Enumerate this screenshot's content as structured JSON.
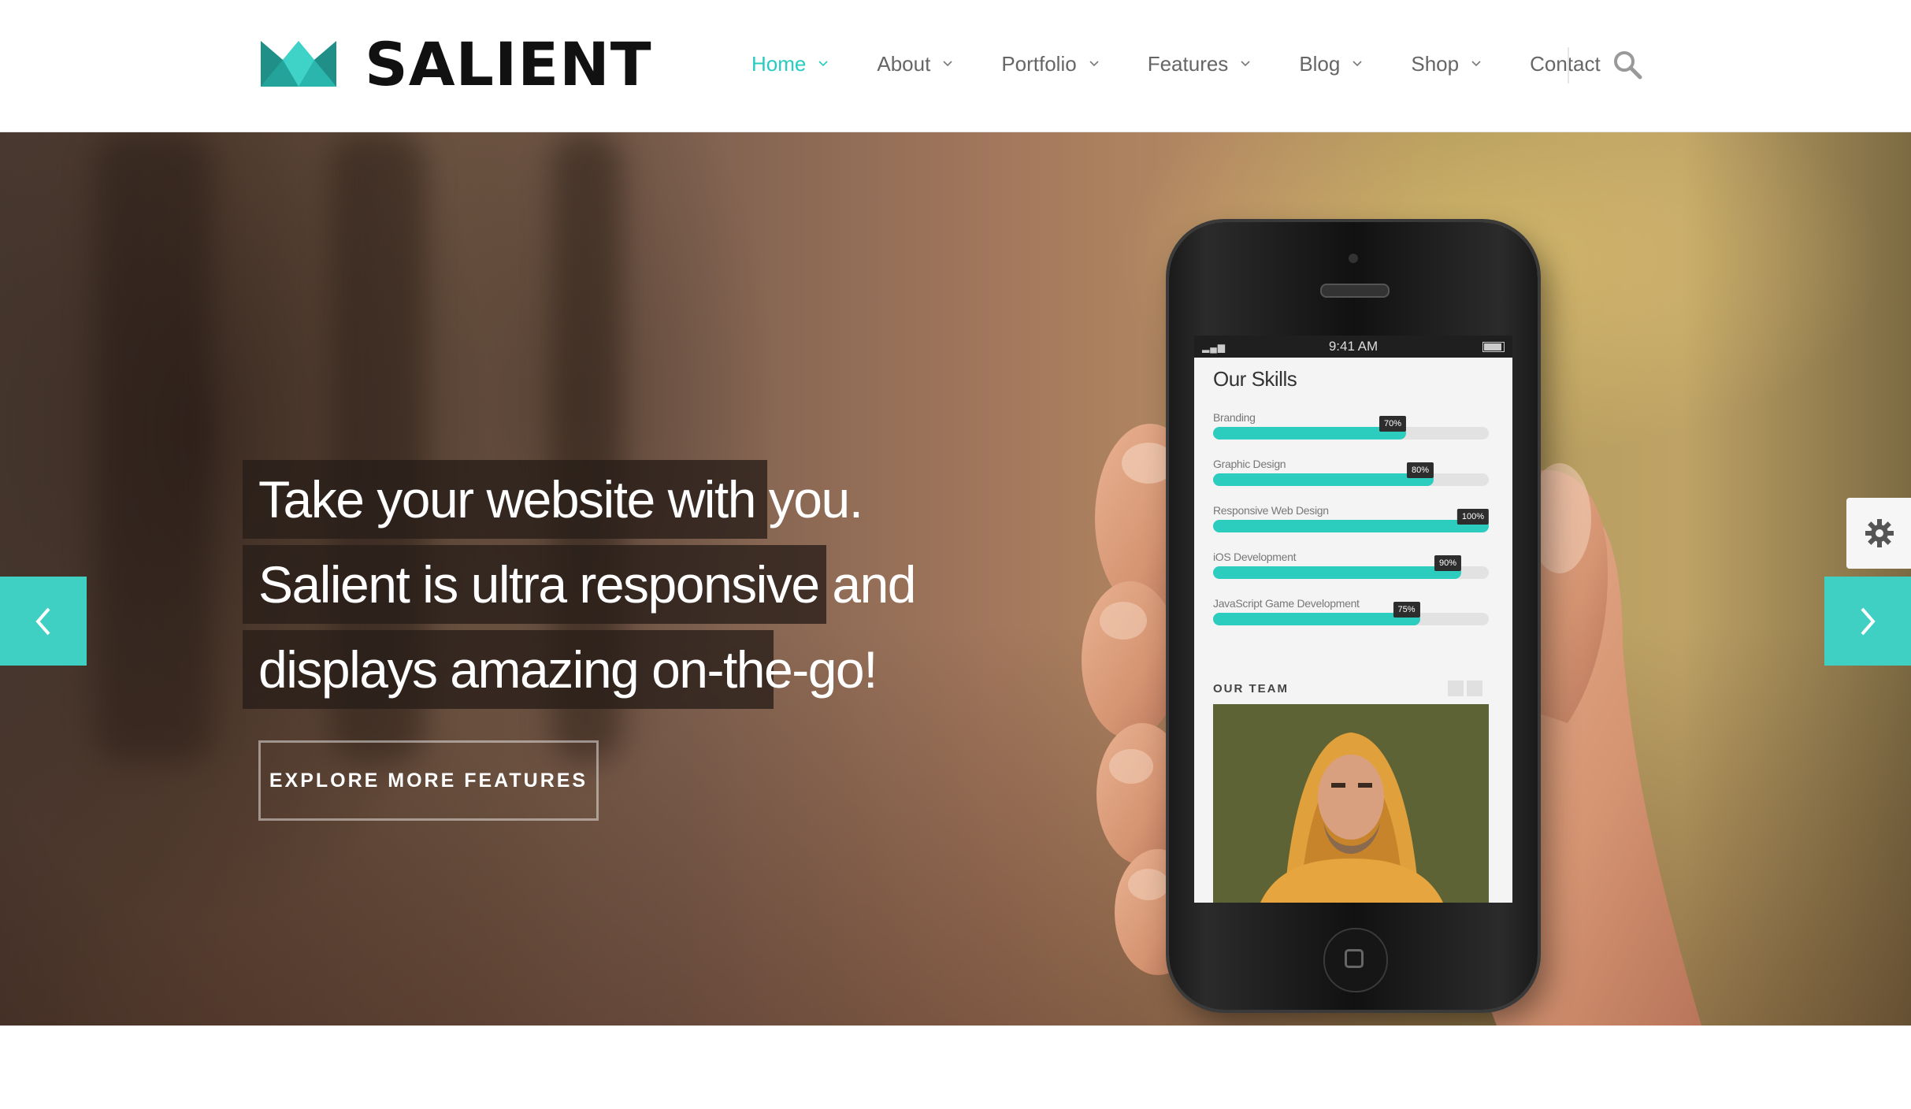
{
  "header": {
    "brand": "SALIENT",
    "logo_color": "#2ab6ac",
    "nav": [
      {
        "label": "Home",
        "active": true,
        "has_dropdown": true
      },
      {
        "label": "About",
        "active": false,
        "has_dropdown": true
      },
      {
        "label": "Portfolio",
        "active": false,
        "has_dropdown": true
      },
      {
        "label": "Features",
        "active": false,
        "has_dropdown": true
      },
      {
        "label": "Blog",
        "active": false,
        "has_dropdown": true
      },
      {
        "label": "Shop",
        "active": false,
        "has_dropdown": true
      },
      {
        "label": "Contact",
        "active": false,
        "has_dropdown": false
      }
    ],
    "search_icon": "search-icon",
    "accent_color": "#27ccc0"
  },
  "hero": {
    "headline_lines": [
      "Take your website with you.",
      "Salient is ultra responsive and",
      "displays amazing on-the-go!"
    ],
    "cta_label": "EXPLORE MORE FEATURES",
    "prev_icon": "chevron-left-icon",
    "next_icon": "chevron-right-icon",
    "settings_icon": "gear-icon",
    "arrow_color": "#3fcfc3"
  },
  "phone": {
    "status_time": "9:41 AM",
    "skills_title": "Our Skills",
    "skills": [
      {
        "name": "Branding",
        "percent": 70,
        "label": "70%"
      },
      {
        "name": "Graphic Design",
        "percent": 80,
        "label": "80%"
      },
      {
        "name": "Responsive Web Design",
        "percent": 100,
        "label": "100%"
      },
      {
        "name": "iOS Development",
        "percent": 90,
        "label": "90%"
      },
      {
        "name": "JavaScript Game Development",
        "percent": 75,
        "label": "75%"
      }
    ],
    "team_title": "OUR TEAM"
  }
}
